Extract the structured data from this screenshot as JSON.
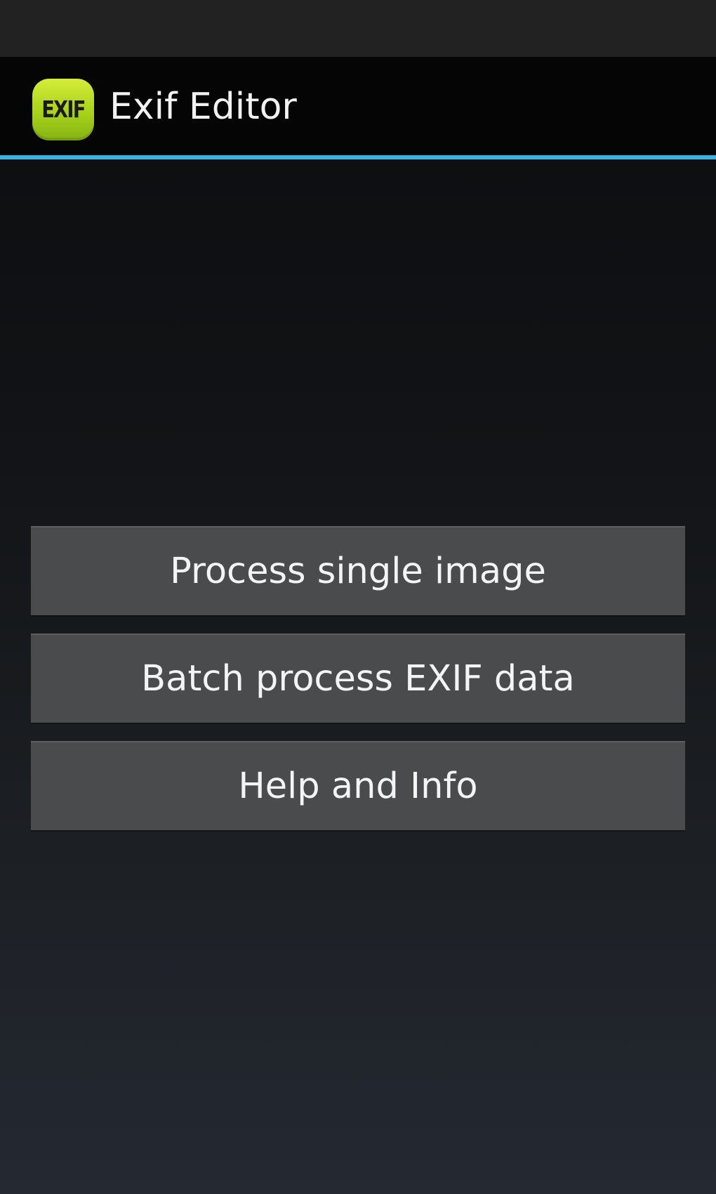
{
  "action_bar": {
    "icon_name": "exif-app-icon",
    "icon_text": "EXIF",
    "title": "Exif Editor",
    "accent_color": "#33b5e5"
  },
  "menu": {
    "buttons": [
      {
        "label": "Process single image"
      },
      {
        "label": "Batch process EXIF data"
      },
      {
        "label": "Help and Info"
      }
    ]
  }
}
